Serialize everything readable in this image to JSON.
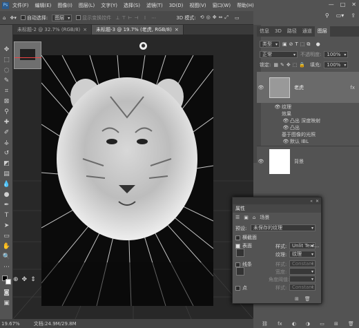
{
  "menu": {
    "items": [
      "文件(F)",
      "编辑(E)",
      "图像(I)",
      "图层(L)",
      "文字(Y)",
      "选择(S)",
      "滤镜(T)",
      "3D(D)",
      "视图(V)",
      "窗口(W)",
      "帮助(H)"
    ],
    "min": "—",
    "max": "□",
    "close": "✕"
  },
  "options": {
    "auto_select": "自动选择:",
    "layer_select": "图层",
    "transform": "显示变换控件",
    "mode_3d": "3D 模式:"
  },
  "tabs": [
    {
      "label": "未标题-2 @ 32.7% (RGB/8)",
      "close": "×"
    },
    {
      "label": "未标题-3 @ 19.7% (老虎, RGB/8)",
      "close": "×"
    }
  ],
  "status": {
    "zoom": "19.67%",
    "doc": "文档:24.9M/29.8M"
  },
  "panel": {
    "tabs": [
      "信息",
      "3D",
      "路径",
      "通道",
      "图层"
    ],
    "kind": "类型",
    "blend": "正常",
    "opacity_label": "不透明度:",
    "opacity": "100%",
    "lock_label": "锁定:",
    "fill_label": "填充:",
    "fill": "100%",
    "layers": [
      {
        "name": "老虎",
        "fx": "fx"
      },
      {
        "name": "纹理"
      },
      {
        "name": "效果"
      },
      {
        "name": "凸出  深度映射"
      },
      {
        "name": "凸出"
      },
      {
        "name": "基于图像的光照"
      },
      {
        "name": "默认 IBL"
      },
      {
        "name": "背景"
      }
    ]
  },
  "properties": {
    "title": "属性",
    "scene": "场景",
    "preset_label": "预设:",
    "preset": "未保存的纹理",
    "opt1": "横截面",
    "opt2": "表面",
    "style_label": "样式:",
    "style": "Unlit Text...",
    "texture_label": "纹理:",
    "texture": "纹理",
    "opt3": "线条",
    "style3": "Constant",
    "width_label": "宽度:",
    "angle_label": "角度阈值:",
    "opt4": "点",
    "style4": "Constant"
  }
}
